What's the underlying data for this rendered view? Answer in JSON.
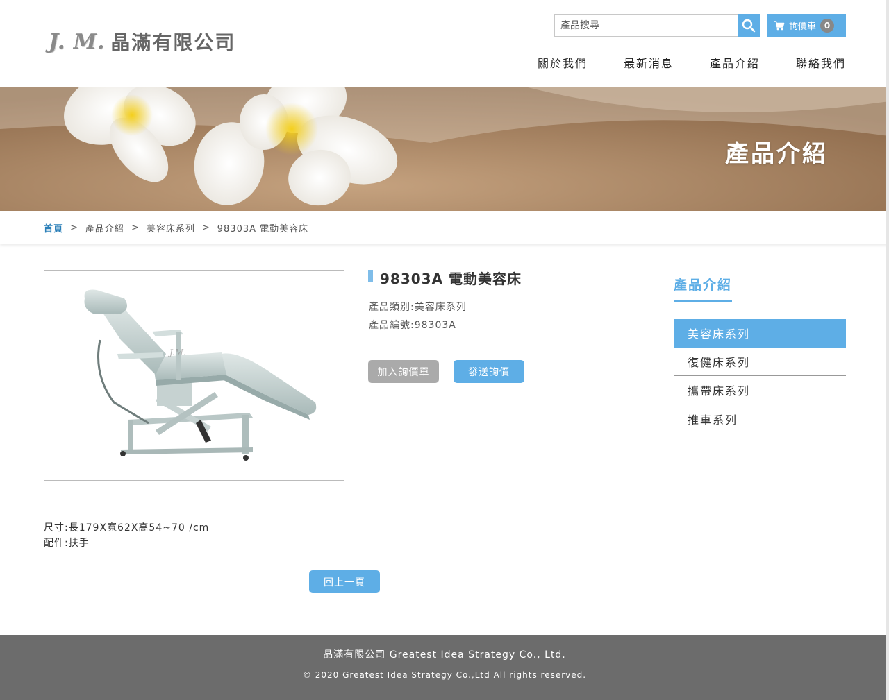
{
  "header": {
    "logo_mark": "J. M.",
    "logo_text": "晶滿有限公司",
    "search_placeholder": "產品搜尋",
    "cart_label": "詢價車",
    "cart_count": "0"
  },
  "nav": {
    "items": [
      "關於我們",
      "最新消息",
      "產品介紹",
      "聯絡我們"
    ]
  },
  "banner": {
    "title": "產品介紹"
  },
  "breadcrumb": {
    "items": [
      "首頁",
      "產品介紹",
      "美容床系列",
      "98303A 電動美容床"
    ],
    "separator": ">"
  },
  "product": {
    "title": "98303A 電動美容床",
    "category": "產品類別:美容床系列",
    "code": "產品編號:98303A",
    "add_label": "加入詢價單",
    "send_label": "發送詢價",
    "size": "尺寸:長179X寬62X高54~70 /cm",
    "accessory": "配件:扶手",
    "watermark": "J.M."
  },
  "sidebar": {
    "title": "產品介紹",
    "items": [
      "美容床系列",
      "復健床系列",
      "攜帶床系列",
      "推車系列"
    ]
  },
  "back_label": "回上一頁",
  "footer": {
    "line1": "晶滿有限公司 Greatest Idea Strategy Co., Ltd.",
    "line2": "© 2020 Greatest Idea Strategy Co.,Ltd All rights reserved."
  },
  "colors": {
    "accent": "#5eaee6",
    "footer_bg": "#6c6c6c",
    "button_gray": "#aaaaaa"
  }
}
